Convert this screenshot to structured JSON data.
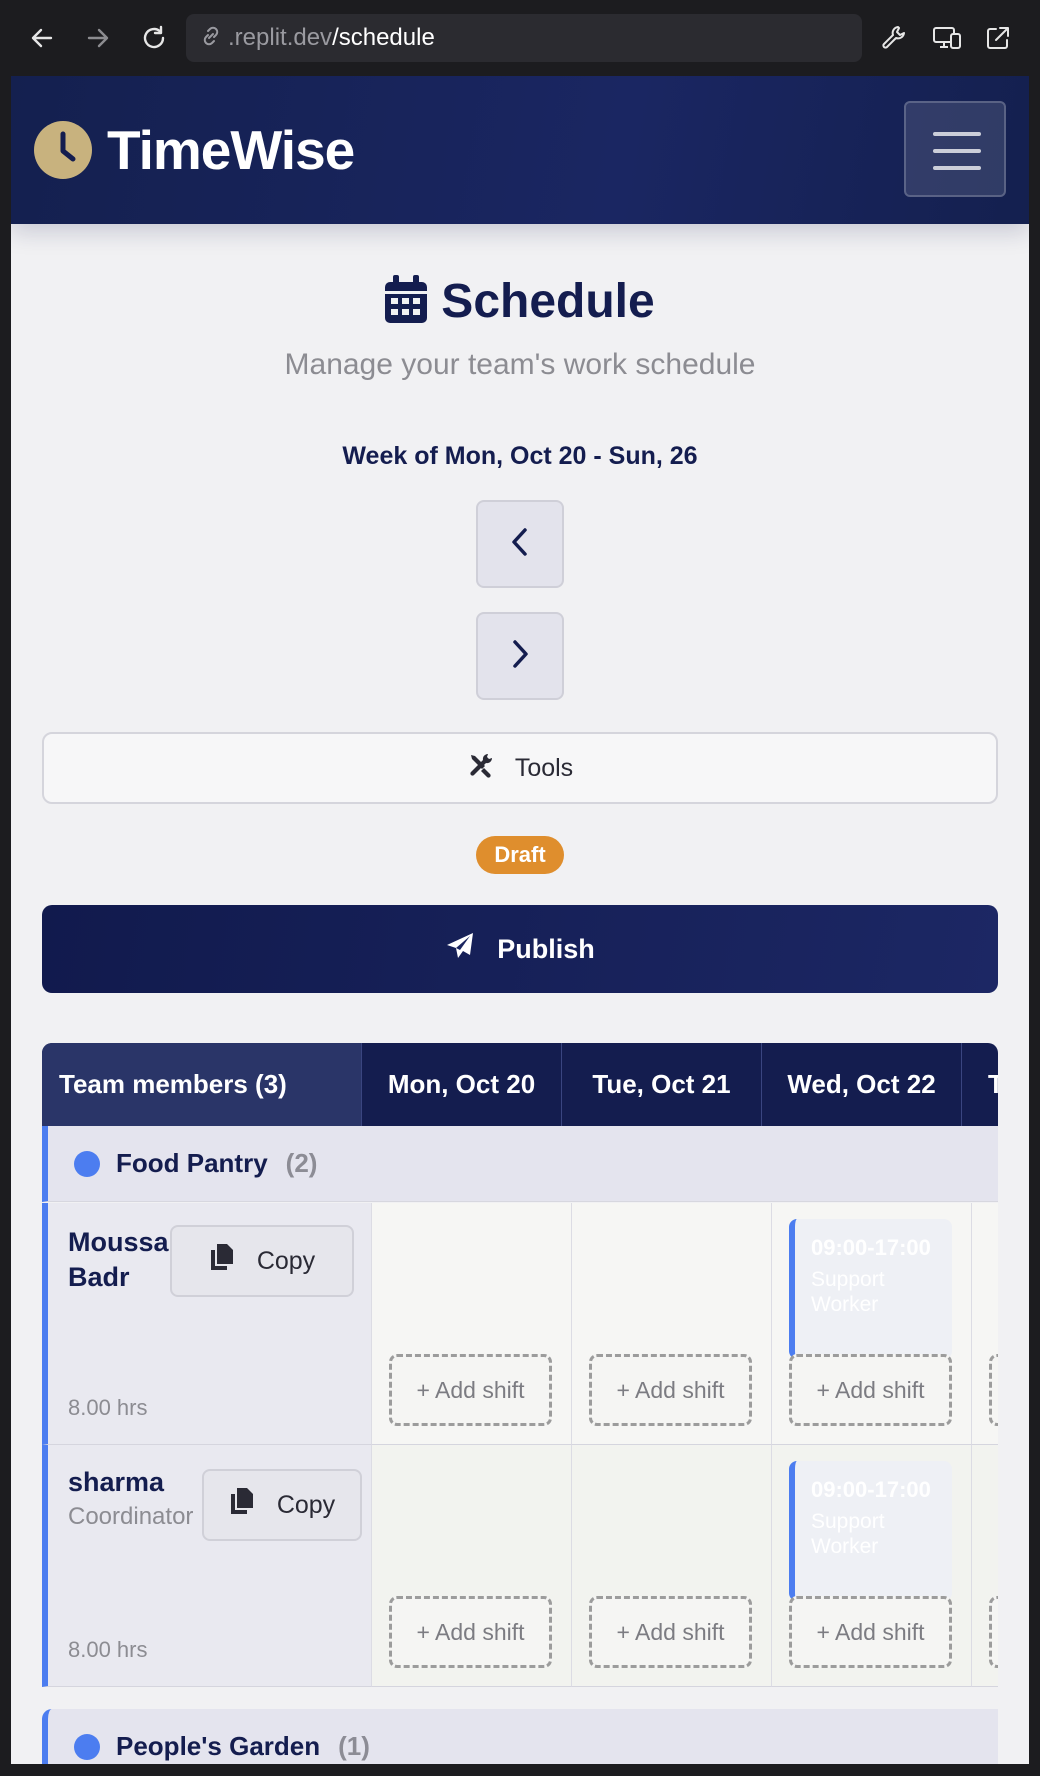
{
  "browser": {
    "url_host": ".replit.dev",
    "url_path": "/schedule"
  },
  "header": {
    "brand": "TimeWise",
    "logo_color": "#c8b27e"
  },
  "page": {
    "title": "Schedule",
    "subtitle": "Manage your team's work schedule",
    "week_label": "Week of Mon, Oct 20 - Sun, 26",
    "tools_label": "Tools",
    "status_badge": "Draft",
    "publish_label": "Publish"
  },
  "table": {
    "members_header": "Team members (3)",
    "days": [
      "Mon, Oct 20",
      "Tue, Oct 21",
      "Wed, Oct 22",
      "T"
    ],
    "add_shift_label": "+ Add shift",
    "groups": [
      {
        "name": "Food Pantry",
        "count": "(2)",
        "color": "#4c7df0",
        "members": [
          {
            "name": "Moussa Badr",
            "role": "",
            "hours": "8.00 hrs",
            "copy_label": "Copy",
            "shifts": [
              {
                "day": "Wed, Oct 22",
                "time": "09:00-17:00",
                "role": "Support Worker"
              }
            ]
          },
          {
            "name": "sharma",
            "role": "Coordinator",
            "hours": "8.00 hrs",
            "copy_label": "Copy",
            "shifts": [
              {
                "day": "Wed, Oct 22",
                "time": "09:00-17:00",
                "role": "Support Worker"
              }
            ]
          }
        ]
      },
      {
        "name": "People's Garden",
        "count": "(1)",
        "color": "#4c7df0",
        "members": []
      }
    ]
  },
  "colors": {
    "primary": "#141d4f",
    "accent": "#4c7df0",
    "draft": "#df8e2d"
  }
}
